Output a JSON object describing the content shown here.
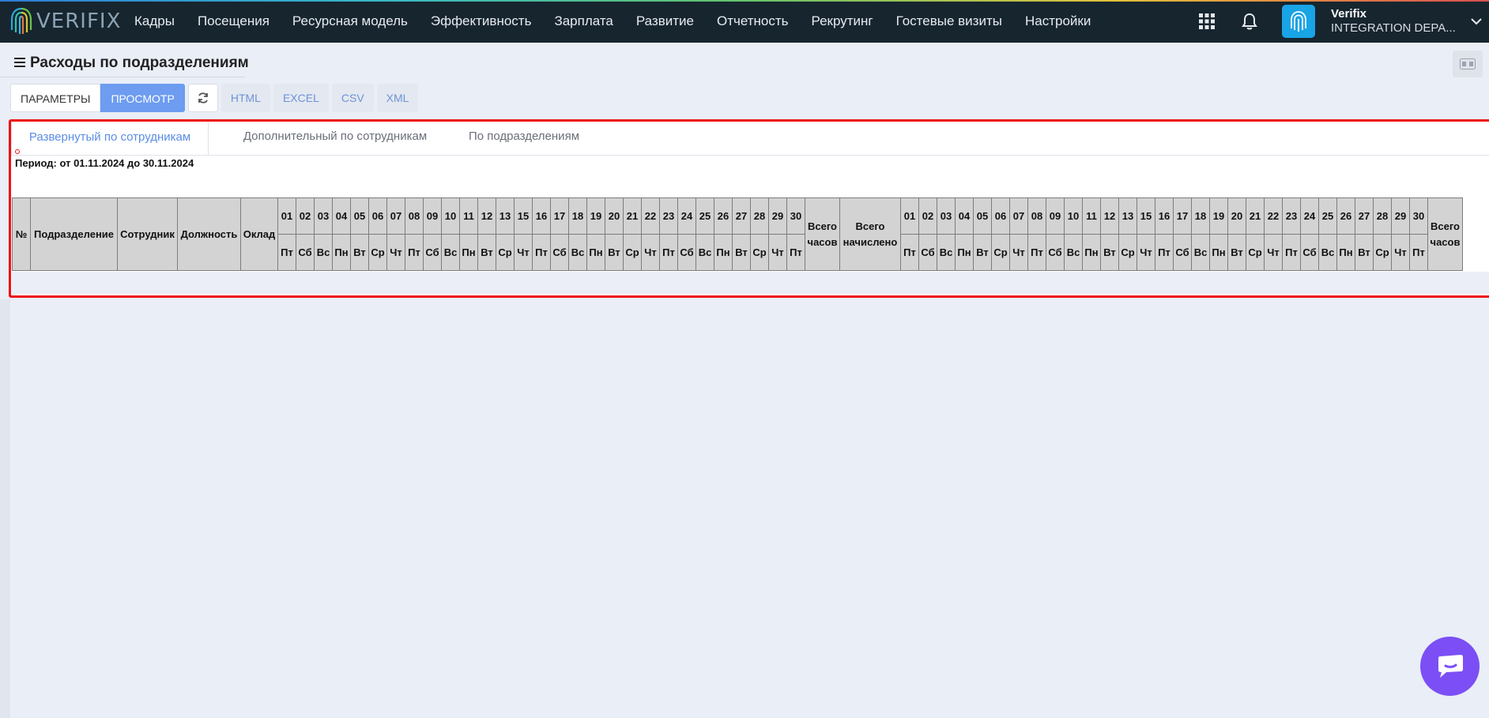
{
  "app": {
    "logo_text": "VERIFIX",
    "menu": [
      "Кадры",
      "Посещения",
      "Ресурсная модель",
      "Эффективность",
      "Зарплата",
      "Развитие",
      "Отчетность",
      "Рекрутинг",
      "Гостевые визиты",
      "Настройки"
    ],
    "user": {
      "name": "Verifix",
      "dept": "INTEGRATION DEPA..."
    },
    "icons": {
      "apps": "apps-grid-icon",
      "notifications": "bell-icon",
      "user": "fingerprint-icon",
      "menu_expand": "chevron-down-icon"
    },
    "colors": {
      "nav_bg": "#17252f",
      "accent": "#6d9cf0",
      "highlight_frame": "#ee1111",
      "chat": "#7b4ff5"
    }
  },
  "page": {
    "title": "Расходы по подразделениям"
  },
  "toolbar": {
    "params_label": "ПАРАМЕТРЫ",
    "view_label": "ПРОСМОТР",
    "exports": [
      "HTML",
      "EXCEL",
      "CSV",
      "XML"
    ]
  },
  "report": {
    "tabs": [
      "Развернутый по сотрудникам",
      "Дополнительный по сотрудникам",
      "По подразделениям"
    ],
    "active_tab": 0,
    "period": "Период: от 01.11.2024 до 30.11.2024",
    "columns": {
      "num": "№",
      "department": "Подразделение",
      "employee": "Сотрудник",
      "position": "Должность",
      "salary": "Оклад",
      "total_hours": "Всего часов",
      "total_accrued": "Всего начислено"
    },
    "days": [
      "01",
      "02",
      "03",
      "04",
      "05",
      "06",
      "07",
      "08",
      "09",
      "10",
      "11",
      "12",
      "13",
      "15",
      "16",
      "17",
      "18",
      "19",
      "20",
      "21",
      "22",
      "23",
      "24",
      "25",
      "26",
      "27",
      "28",
      "29",
      "30"
    ],
    "weekdays": [
      "Пт",
      "Сб",
      "Вс",
      "Пн",
      "Вт",
      "Ср",
      "Чт",
      "Пт",
      "Сб",
      "Вс",
      "Пн",
      "Вт",
      "Ср",
      "Чт",
      "Пт",
      "Сб",
      "Вс",
      "Пн",
      "Вт",
      "Ср",
      "Чт",
      "Пт",
      "Сб",
      "Вс",
      "Пн",
      "Вт",
      "Ср",
      "Чт",
      "Пт",
      "Сб"
    ],
    "rows": []
  }
}
